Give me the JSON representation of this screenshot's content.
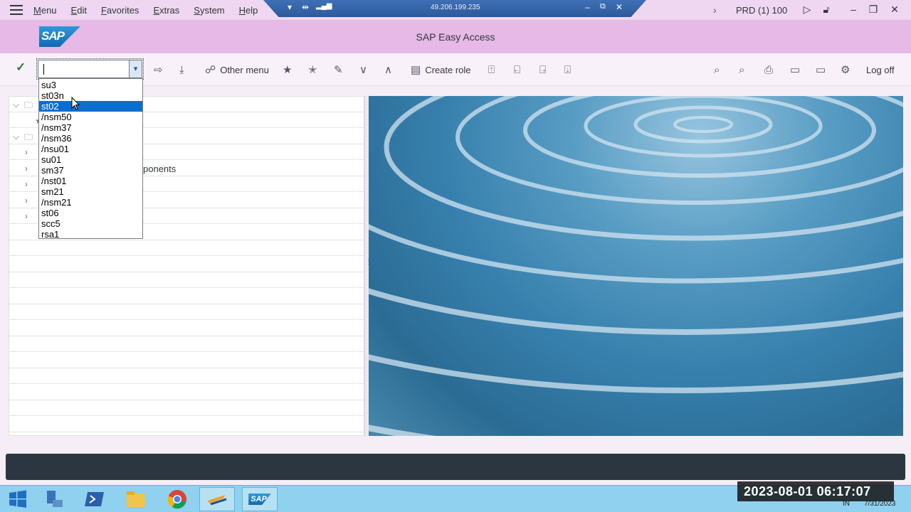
{
  "menubar": {
    "items": [
      "Menu",
      "Edit",
      "Favorites",
      "Extras",
      "System",
      "Help"
    ],
    "remote_ip": "49.206.199.235",
    "system": "PRD (1) 100"
  },
  "title": "SAP Easy Access",
  "logo_text": "SAP",
  "toolbar": {
    "other_menu": "Other menu",
    "create_role": "Create role",
    "log_off": "Log off"
  },
  "command_field": {
    "value": ""
  },
  "dropdown": {
    "items": [
      "su3",
      "st03n",
      "st02",
      "/nsm50",
      "/nsm37",
      "/nsm36",
      "/nsu01",
      "su01",
      "sm37",
      "/nst01",
      "sm21",
      "/nsm21",
      "st06",
      "scc5",
      "rsa1"
    ],
    "selected_index": 2
  },
  "tree": {
    "partial_text": "ponents"
  },
  "taskbar": {
    "sap_label": "SAP"
  },
  "clock": {
    "overlay": "2023-08-01  06:17:07",
    "date_small": "7/31/2023",
    "lang": "IN"
  },
  "colors": {
    "title_bar": "#e6b9e6",
    "menu_bar": "#efd7f1",
    "selection": "#0a6ed1",
    "status_bar": "#2b3640",
    "taskbar": "#8fd1ee"
  }
}
